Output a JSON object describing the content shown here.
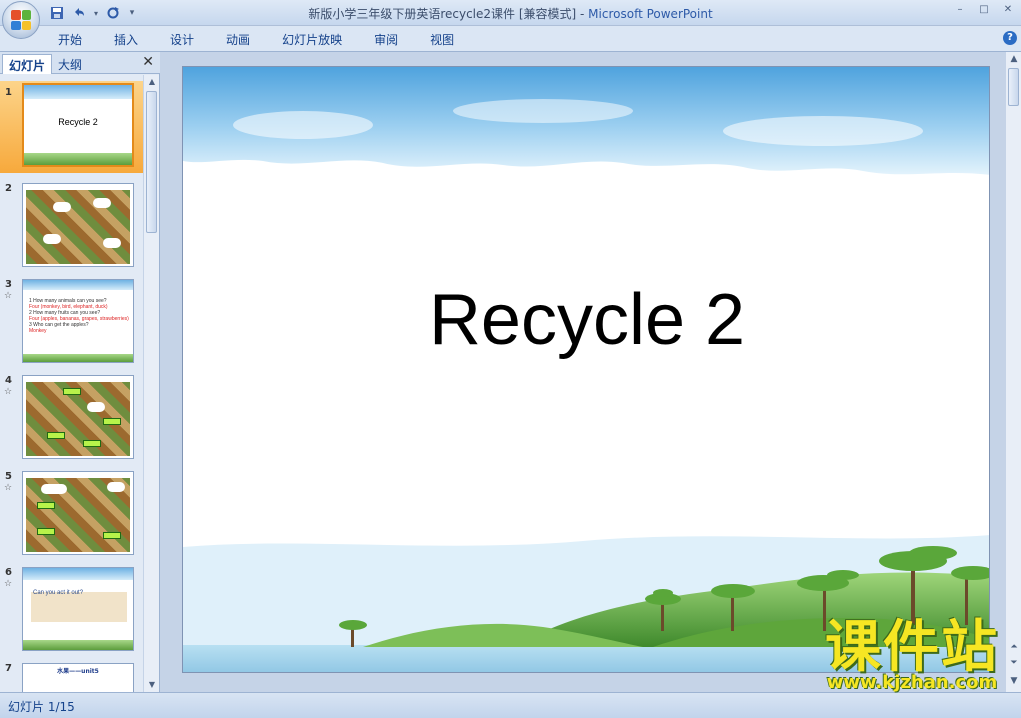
{
  "window": {
    "title": "新版小学三年级下册英语recycle2课件 [兼容模式]",
    "app_name": "Microsoft PowerPoint",
    "separator": " - "
  },
  "ribbon": {
    "tabs": [
      {
        "label": "开始"
      },
      {
        "label": "插入"
      },
      {
        "label": "设计"
      },
      {
        "label": "动画"
      },
      {
        "label": "幻灯片放映"
      },
      {
        "label": "审阅"
      },
      {
        "label": "视图"
      }
    ]
  },
  "pane": {
    "tab_slides": "幻灯片",
    "tab_outline": "大纲",
    "thumbnails": [
      {
        "number": "1",
        "title": "Recycle 2"
      },
      {
        "number": "2"
      },
      {
        "number": "3",
        "lines": [
          "1 How many animals can you see?",
          "Four (monkey, bird, elephant, duck)",
          "2 How many fruits can you see?",
          "Four (apples, bananas, grapes, strawberries)",
          "3 Who can get the apples?",
          "Monkey"
        ]
      },
      {
        "number": "4"
      },
      {
        "number": "5"
      },
      {
        "number": "6",
        "text": "Can you act it out?"
      },
      {
        "number": "7",
        "text": "水果——unit5"
      }
    ]
  },
  "slide": {
    "title": "Recycle 2"
  },
  "status": {
    "slide_counter": "幻灯片 1/15"
  },
  "watermark": {
    "brand": "课件站",
    "url": "www.kjzhan.com"
  },
  "colors": {
    "selected_thumb": "#f7a93c",
    "ribbon_text": "#15428b",
    "watermark_yellow": "#f6e623"
  }
}
